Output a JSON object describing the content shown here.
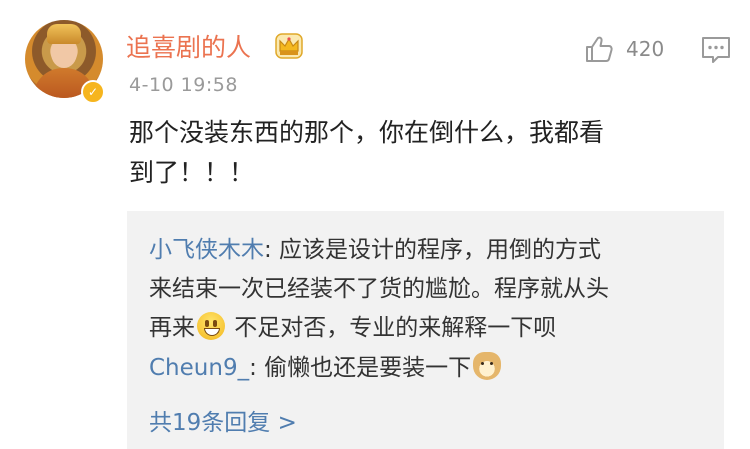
{
  "post": {
    "username": "追喜剧的人",
    "timestamp": "4-10 19:58",
    "like_count": "420",
    "content_line1": "那个没装东西的那个，你在倒什么，我都看",
    "content_line2": "到了！！！"
  },
  "replies": {
    "items": [
      {
        "author": "小飞侠木木",
        "line1": ": 应该是设计的程序，用倒的方式",
        "line2": "来结束一次已经装不了货的尴尬。程序就从头",
        "line3_before": "再来",
        "line3_after": " 不足对否，专业的来解释一下呗"
      },
      {
        "author": "Cheun9_",
        "text": ": 偷懒也还是要装一下"
      }
    ],
    "more_label": "共19条回复 >"
  },
  "colors": {
    "username": "#eb7350",
    "link": "#507daf",
    "reply_background": "#f2f2f2",
    "timestamp": "#9a9a9a"
  },
  "icons": {
    "like": "thumbs-up-icon",
    "comment": "comment-icon",
    "member": "crown-icon",
    "verified": "verified-badge-icon"
  }
}
